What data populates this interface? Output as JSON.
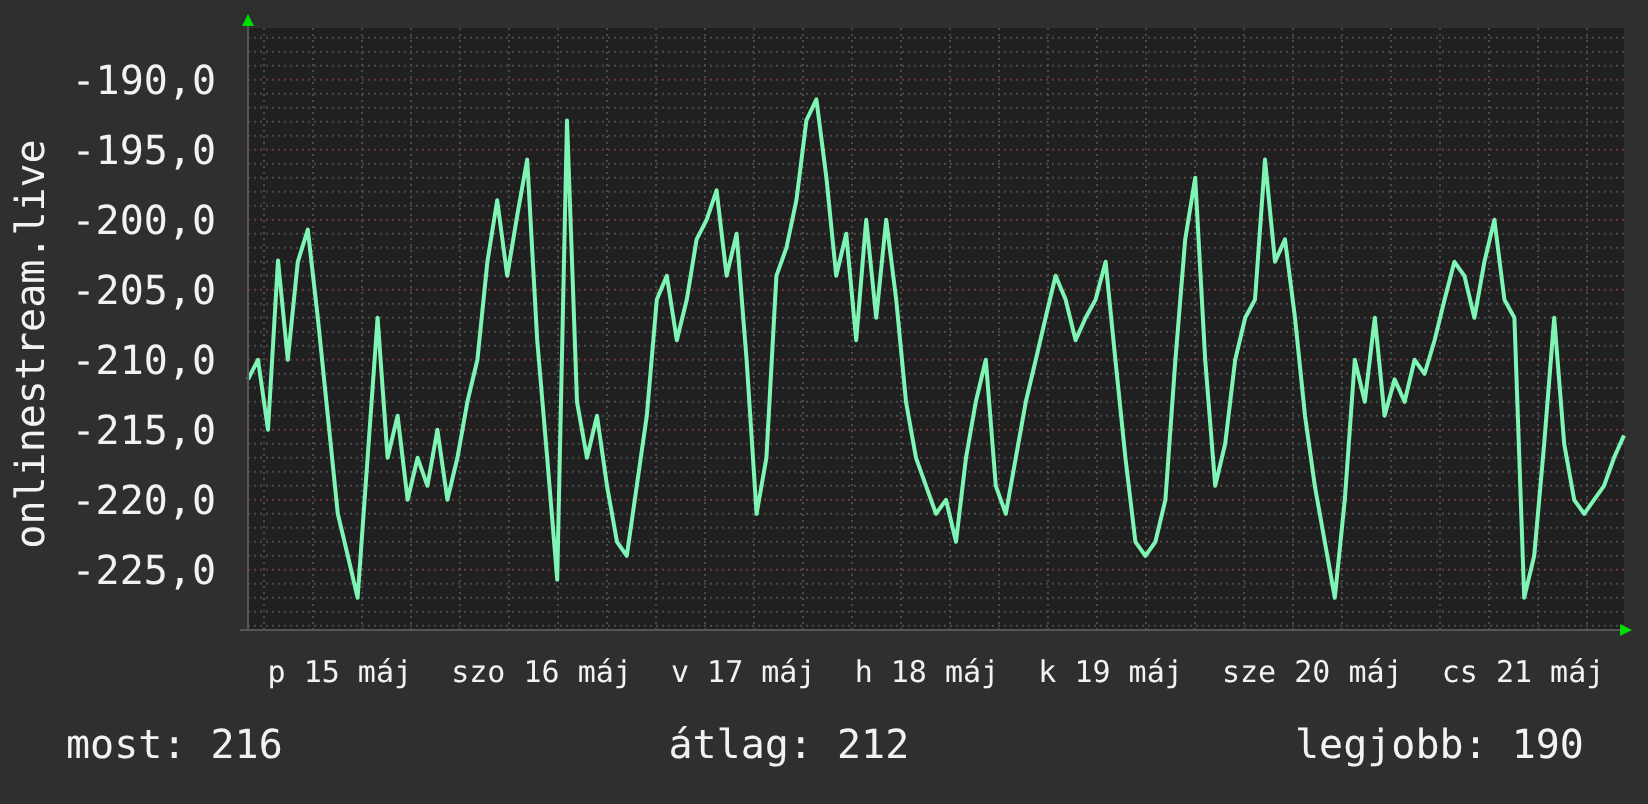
{
  "chart": {
    "chart_data": {
      "type": "line",
      "ylabel": "onlinestream.live",
      "ylim": [
        -229.3,
        -186.3
      ],
      "yticks": [
        {
          "value": -190,
          "label": "-190,0"
        },
        {
          "value": -195,
          "label": "-195,0"
        },
        {
          "value": -200,
          "label": "-200,0"
        },
        {
          "value": -205,
          "label": "-205,0"
        },
        {
          "value": -210,
          "label": "-210,0"
        },
        {
          "value": -215,
          "label": "-215,0"
        },
        {
          "value": -220,
          "label": "-220,0"
        },
        {
          "value": -225,
          "label": "-225,0"
        }
      ],
      "grid": true,
      "series": [
        {
          "color": "#7ff5b5",
          "values": [
            -211.4,
            -210,
            -215,
            -202.9,
            -210,
            -203,
            -200.7,
            -207,
            -214,
            -221,
            -224,
            -227,
            -217,
            -207,
            -217,
            -214,
            -220,
            -217,
            -219,
            -215,
            -220,
            -217,
            -213,
            -210,
            -203,
            -198.6,
            -204,
            -199.7,
            -195.7,
            -208.6,
            -217,
            -225.7,
            -192.9,
            -213,
            -217,
            -214,
            -219,
            -223,
            -224,
            -219,
            -214,
            -205.7,
            -204,
            -208.6,
            -205.7,
            -201.4,
            -200,
            -197.9,
            -204,
            -201,
            -210,
            -221,
            -217,
            -204,
            -202,
            -198.6,
            -192.9,
            -191.4,
            -197,
            -204,
            -201,
            -208.6,
            -200,
            -207,
            -200,
            -205.7,
            -213,
            -217,
            -219,
            -221,
            -220,
            -223,
            -217,
            -213,
            -210,
            -219,
            -221,
            -217,
            -213,
            -210,
            -207,
            -204,
            -205.7,
            -208.6,
            -207,
            -205.7,
            -203,
            -210,
            -217,
            -223,
            -224,
            -223,
            -220,
            -210,
            -201.4,
            -197,
            -210,
            -219,
            -216,
            -210,
            -207,
            -205.7,
            -195.7,
            -203,
            -201.4,
            -207,
            -214,
            -219,
            -223,
            -227,
            -220,
            -210,
            -213,
            -207,
            -214,
            -211.4,
            -213,
            -210,
            -211,
            -208.6,
            -205.7,
            -203,
            -204,
            -207,
            -203,
            -200,
            -205.7,
            -207,
            -227,
            -224,
            -216,
            -207,
            -216,
            -220,
            -221,
            -220,
            -219,
            -217,
            -215.4
          ]
        }
      ]
    },
    "x_labels": [
      "p 15 máj",
      "szo 16 máj",
      "v 17 máj",
      "h 18 máj",
      "k 19 máj",
      "sze 20 máj",
      "cs 21 máj"
    ]
  },
  "stats": [
    {
      "text": "most: 216"
    },
    {
      "text": "átlag: 212"
    },
    {
      "text": "legjobb: 190"
    }
  ]
}
